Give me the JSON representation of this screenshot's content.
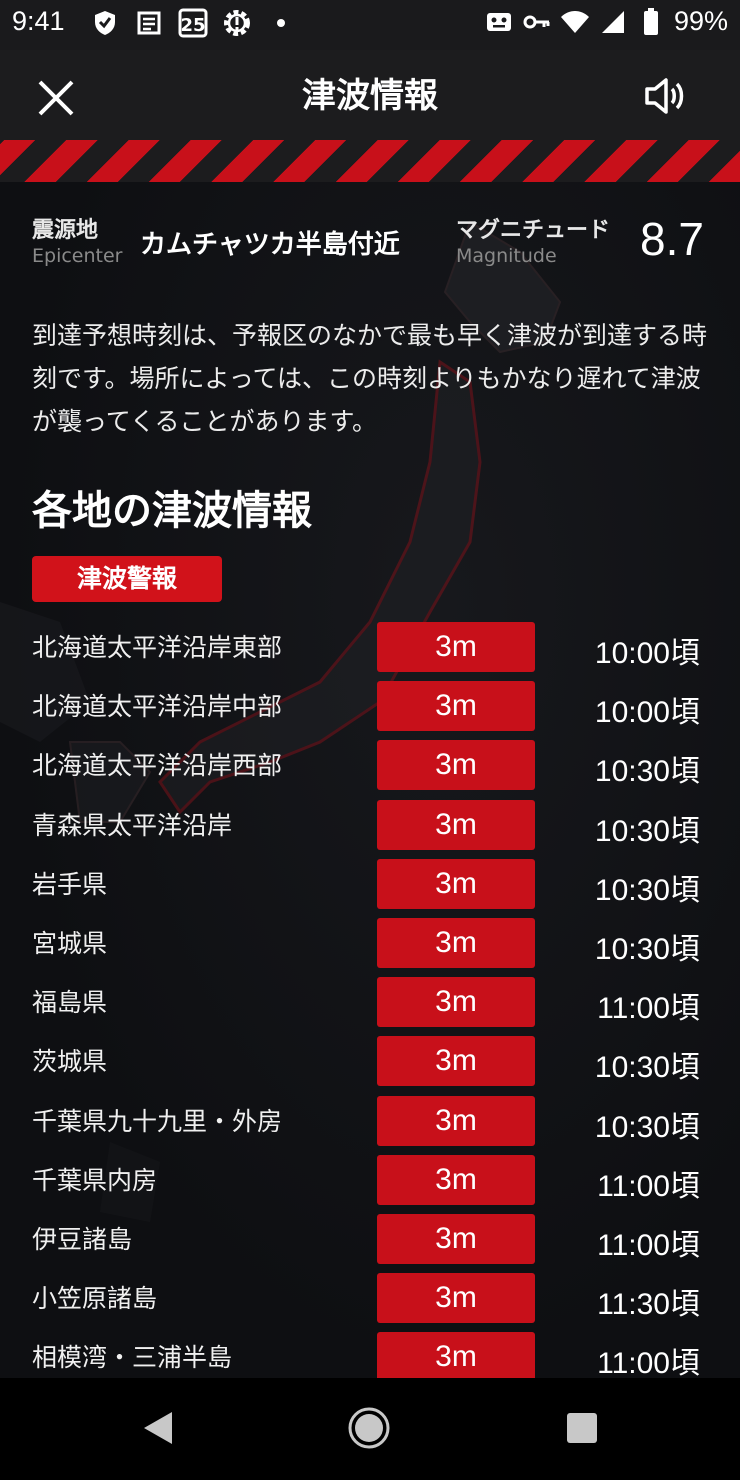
{
  "status_bar": {
    "time": "9:41",
    "calendar_day": "25",
    "battery": "99%",
    "left_icons": [
      "shield-icon",
      "news-icon",
      "calendar-icon",
      "alert-gear-icon",
      "dot-icon"
    ],
    "right_icons": [
      "face-icon",
      "key-icon",
      "wifi-icon",
      "signal-icon",
      "battery-icon"
    ]
  },
  "header": {
    "title": "津波情報",
    "close_icon": "close-icon",
    "speaker_icon": "speaker-icon"
  },
  "epicenter": {
    "label_jp": "震源地",
    "label_en": "Epicenter",
    "place": "カムチャツカ半島付近",
    "magnitude_label_jp": "マグニチュード",
    "magnitude_label_en": "Magnitude",
    "magnitude_value": "8.7"
  },
  "note": "到達予想時刻は、予報区のなかで最も早く津波が到達する時刻です。場所によっては、この時刻よりもかなり遅れて津波が襲ってくることがあります。",
  "section_title": "各地の津波情報",
  "warning_badge": "津波警報",
  "rows": [
    {
      "area": "北海道太平洋沿岸東部",
      "height": "3m",
      "time": "10:00頃"
    },
    {
      "area": "北海道太平洋沿岸中部",
      "height": "3m",
      "time": "10:00頃"
    },
    {
      "area": "北海道太平洋沿岸西部",
      "height": "3m",
      "time": "10:30頃"
    },
    {
      "area": "青森県太平洋沿岸",
      "height": "3m",
      "time": "10:30頃"
    },
    {
      "area": "岩手県",
      "height": "3m",
      "time": "10:30頃"
    },
    {
      "area": "宮城県",
      "height": "3m",
      "time": "10:30頃"
    },
    {
      "area": "福島県",
      "height": "3m",
      "time": "11:00頃"
    },
    {
      "area": "茨城県",
      "height": "3m",
      "time": "10:30頃"
    },
    {
      "area": "千葉県九十九里・外房",
      "height": "3m",
      "time": "10:30頃"
    },
    {
      "area": "千葉県内房",
      "height": "3m",
      "time": "11:00頃"
    },
    {
      "area": "伊豆諸島",
      "height": "3m",
      "time": "11:00頃"
    },
    {
      "area": "小笠原諸島",
      "height": "3m",
      "time": "11:30頃"
    },
    {
      "area": "相模湾・三浦半島",
      "height": "3m",
      "time": "11:00頃"
    }
  ],
  "colors": {
    "warning_red": "#c8101a",
    "background": "#0e0f12",
    "header_bg": "#1c1c1e"
  },
  "nav": {
    "back_icon": "back-icon",
    "home_icon": "home-icon",
    "recent_icon": "recent-apps-icon"
  }
}
